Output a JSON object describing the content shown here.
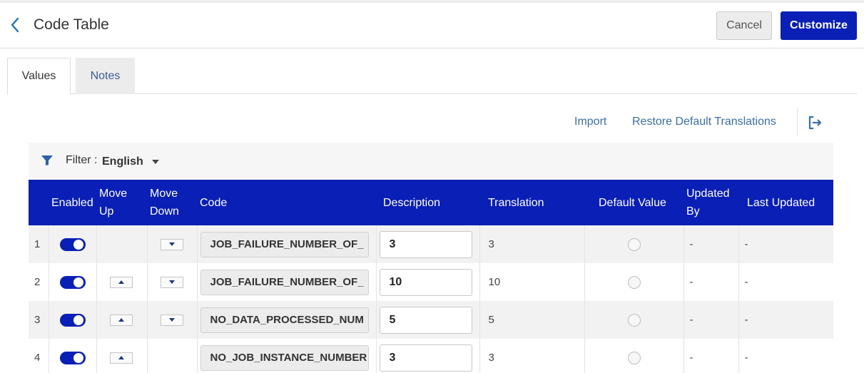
{
  "header": {
    "back_icon": "chevron-left-icon",
    "title": "Code Table",
    "cancel_label": "Cancel",
    "customize_label": "Customize"
  },
  "tabs": [
    {
      "label": "Values",
      "active": true
    },
    {
      "label": "Notes",
      "active": false
    }
  ],
  "actions": {
    "import_label": "Import",
    "restore_label": "Restore Default Translations",
    "export_icon": "export-icon"
  },
  "filter": {
    "label": "Filter :",
    "value": "English"
  },
  "table": {
    "columns": {
      "enabled": "Enabled",
      "move_up": "Move Up",
      "move_down_1": "Move",
      "move_down_2": "Down",
      "code": "Code",
      "description": "Description",
      "translation": "Translation",
      "default_value": "Default Value",
      "updated_by_1": "Updated",
      "updated_by_2": "By",
      "last_updated": "Last Updated"
    },
    "rows": [
      {
        "num": "1",
        "code": "JOB_FAILURE_NUMBER_OF_",
        "description": "3",
        "translation": "3",
        "updated_by": "-",
        "last_updated": "-"
      },
      {
        "num": "2",
        "code": "JOB_FAILURE_NUMBER_OF_",
        "description": "10",
        "translation": "10",
        "updated_by": "-",
        "last_updated": "-"
      },
      {
        "num": "3",
        "code": "NO_DATA_PROCESSED_NUM",
        "description": "5",
        "translation": "5",
        "updated_by": "-",
        "last_updated": "-"
      },
      {
        "num": "4",
        "code": "NO_JOB_INSTANCE_NUMBER",
        "description": "3",
        "translation": "3",
        "updated_by": "-",
        "last_updated": "-"
      }
    ]
  },
  "colors": {
    "primary": "#0a1fb5",
    "link": "#3b6ea6"
  }
}
